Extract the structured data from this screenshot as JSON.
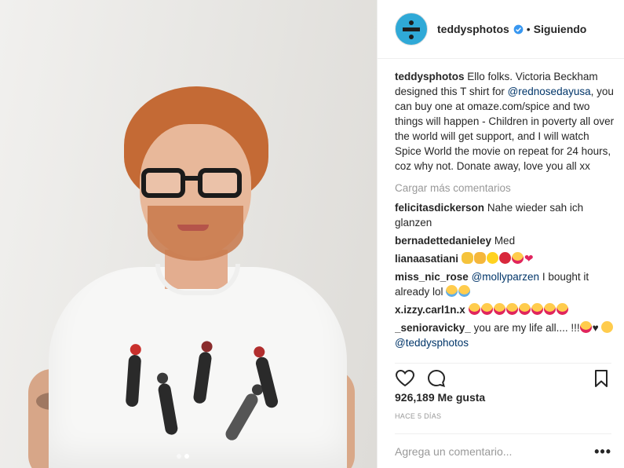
{
  "header": {
    "username": "teddysphotos",
    "separator": "•",
    "follow_label": "Siguiendo",
    "verified_icon": "verified-badge-icon"
  },
  "caption": {
    "username": "teddysphotos",
    "text_before": "Ello folks. Victoria Beckham designed this T shirt for ",
    "mention": "@rednosedayusa",
    "text_after": ", you can buy one at omaze.com/spice and two things will happen - Children in poverty all over the world will get support, and I will watch Spice World the movie on repeat for 24 hours, coz why not. Donate away, love you all xx"
  },
  "load_more_label": "Cargar más comentarios",
  "comments": [
    {
      "username": "felicitasdickerson",
      "text": "Nahe wieder sah ich glanzen"
    },
    {
      "username": "bernadettedanieley",
      "text": "Med"
    },
    {
      "username": "lianaasatiani",
      "text": "",
      "emojis": [
        "ok-hand",
        "clap",
        "sun",
        "rose",
        "heart-eyes",
        "red-heart"
      ]
    },
    {
      "username": "miss_nic_rose",
      "mention": "@mollyparzen",
      "text": " I bought it already lol",
      "emojis": [
        "joy",
        "joy"
      ]
    },
    {
      "username": "x.izzy.carl1n.x",
      "text": "",
      "emojis": [
        "heart-eyes",
        "heart-eyes",
        "heart-eyes",
        "heart-eyes",
        "heart-eyes",
        "heart-eyes",
        "heart-eyes",
        "heart-eyes"
      ]
    },
    {
      "username": "_senioravicky_",
      "text": "you are my life all.... !!!",
      "mention": "@teddysphotos"
    }
  ],
  "likes_text": "926,189 Me gusta",
  "time_text": "HACE 5 DÍAS",
  "add_comment_placeholder": "Agrega un comentario...",
  "more_options": "•••",
  "carousel": {
    "count": 2,
    "active": 1
  },
  "colors": {
    "link": "#003569",
    "muted": "#999999",
    "text": "#262626",
    "border": "#efefef",
    "verified": "#3897f0"
  }
}
